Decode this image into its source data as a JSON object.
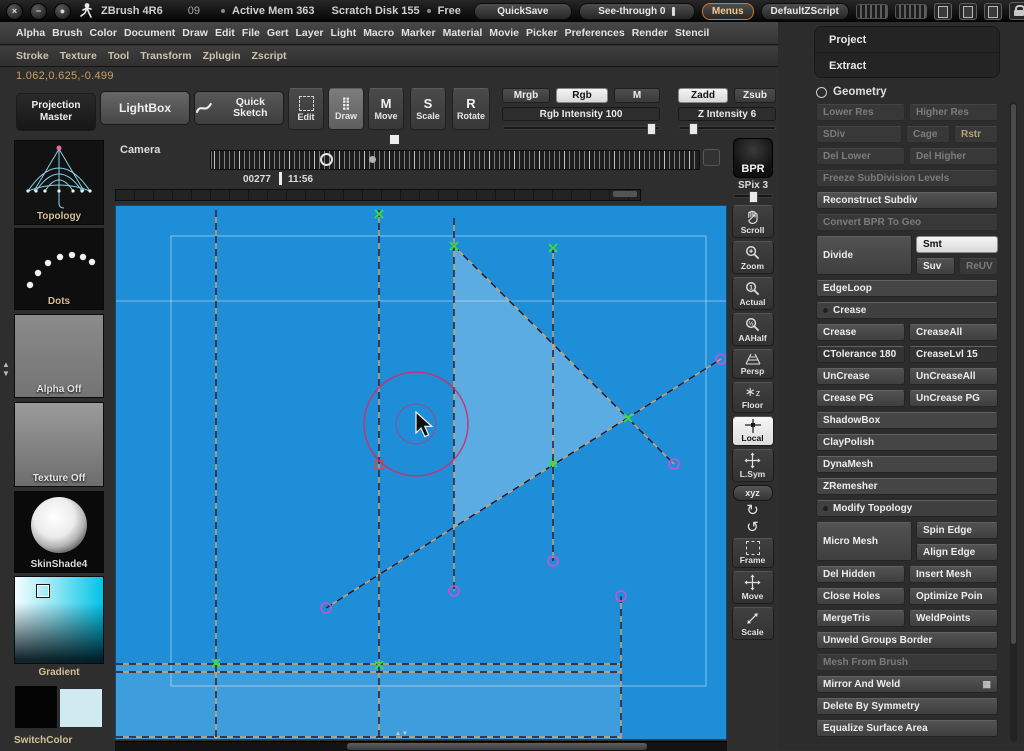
{
  "titlebar": {
    "app_title": "ZBrush 4R6",
    "doc_number": "09",
    "active_mem": "Active Mem 363",
    "scratch_disk": "Scratch Disk 155",
    "free_label": "Free",
    "quicksave": "QuickSave",
    "see_through": "See-through 0",
    "menus": "Menus",
    "default_zscript": "DefaultZScript"
  },
  "menus_row1": [
    "Alpha",
    "Brush",
    "Color",
    "Document",
    "Draw",
    "Edit",
    "File",
    "Gert",
    "Layer",
    "Light",
    "Macro",
    "Marker",
    "Material",
    "Movie",
    "Picker",
    "Preferences",
    "Render",
    "Stencil"
  ],
  "menus_row2": [
    "Stroke",
    "Texture",
    "Tool",
    "Transform",
    "Zplugin",
    "Zscript"
  ],
  "coordinates": "1.062,0.625,-0.499",
  "toolbar": {
    "projection_master": "Projection Master",
    "lightbox": "LightBox",
    "quick_sketch": "Quick Sketch",
    "edit": "Edit",
    "draw": "Draw",
    "move": "Move",
    "scale": "Scale",
    "rotate": "Rotate",
    "mrgb": "Mrgb",
    "rgb": "Rgb",
    "m": "M",
    "rgb_intensity": "Rgb Intensity 100",
    "zadd": "Zadd",
    "zsub": "Zsub",
    "z_intensity": "Z Intensity 6"
  },
  "timeline": {
    "camera": "Camera",
    "frame": "00277",
    "time": "11:56",
    "bpr": "BPR",
    "spix": "SPix 3"
  },
  "left_panel": {
    "brush_name": "Topology",
    "stroke_name": "Dots",
    "alpha_name": "Alpha Off",
    "texture_name": "Texture Off",
    "material_name": "SkinShade4",
    "gradient_label": "Gradient",
    "switch_color": "SwitchColor"
  },
  "right_column": {
    "scroll": "Scroll",
    "zoom": "Zoom",
    "actual": "Actual",
    "aahalf": "AAHalf",
    "persp": "Persp",
    "floor": "Floor",
    "local": "Local",
    "lsym": "L.Sym",
    "gxyz": "xyz",
    "frame": "Frame",
    "move": "Move",
    "scale": "Scale"
  },
  "tool_panel": {
    "project": "Project",
    "extract": "Extract",
    "section_title": "Geometry",
    "lower_res": "Lower Res",
    "higher_res": "Higher Res",
    "sdiv": "SDiv",
    "cage": "Cage",
    "rstr": "Rstr",
    "del_lower": "Del Lower",
    "del_higher": "Del Higher",
    "freeze_subdivision": "Freeze SubDivision Levels",
    "reconstruct_subdiv": "Reconstruct Subdiv",
    "convert_bpr": "Convert BPR To Geo",
    "divide": "Divide",
    "smt": "Smt",
    "suv": "Suv",
    "reuv": "ReUV",
    "edgeloop": "EdgeLoop",
    "crease_header": "Crease",
    "crease": "Crease",
    "crease_all": "CreaseAll",
    "ctolerance": "CTolerance 180",
    "crease_lvl": "CreaseLvl 15",
    "uncrease": "UnCrease",
    "uncrease_all": "UnCreaseAll",
    "crease_pg": "Crease PG",
    "uncrease_pg": "UnCrease PG",
    "shadowbox": "ShadowBox",
    "claypolish": "ClayPolish",
    "dynamesh": "DynaMesh",
    "zremesher": "ZRemesher",
    "modify_topology": "Modify Topology",
    "micro_mesh": "Micro Mesh",
    "spin_edge": "Spin Edge",
    "align_edge": "Align Edge",
    "del_hidden": "Del Hidden",
    "insert_mesh": "Insert Mesh",
    "close_holes": "Close Holes",
    "optimize_points": "Optimize Poin",
    "merge_tris": "MergeTris",
    "weld_points": "WeldPoints",
    "unweld_groups": "Unweld Groups Border",
    "mesh_from_brush": "Mesh From Brush",
    "mirror_and_weld": "Mirror And Weld",
    "delete_by_symmetry": "Delete By Symmetry",
    "equalize_surface": "Equalize Surface Area"
  },
  "colors": {
    "canvas_blue": "#1f8ed8",
    "selected_button": "#e9e9e9",
    "accent_tan": "#c9a06a",
    "menus_orange": "#c87830"
  }
}
